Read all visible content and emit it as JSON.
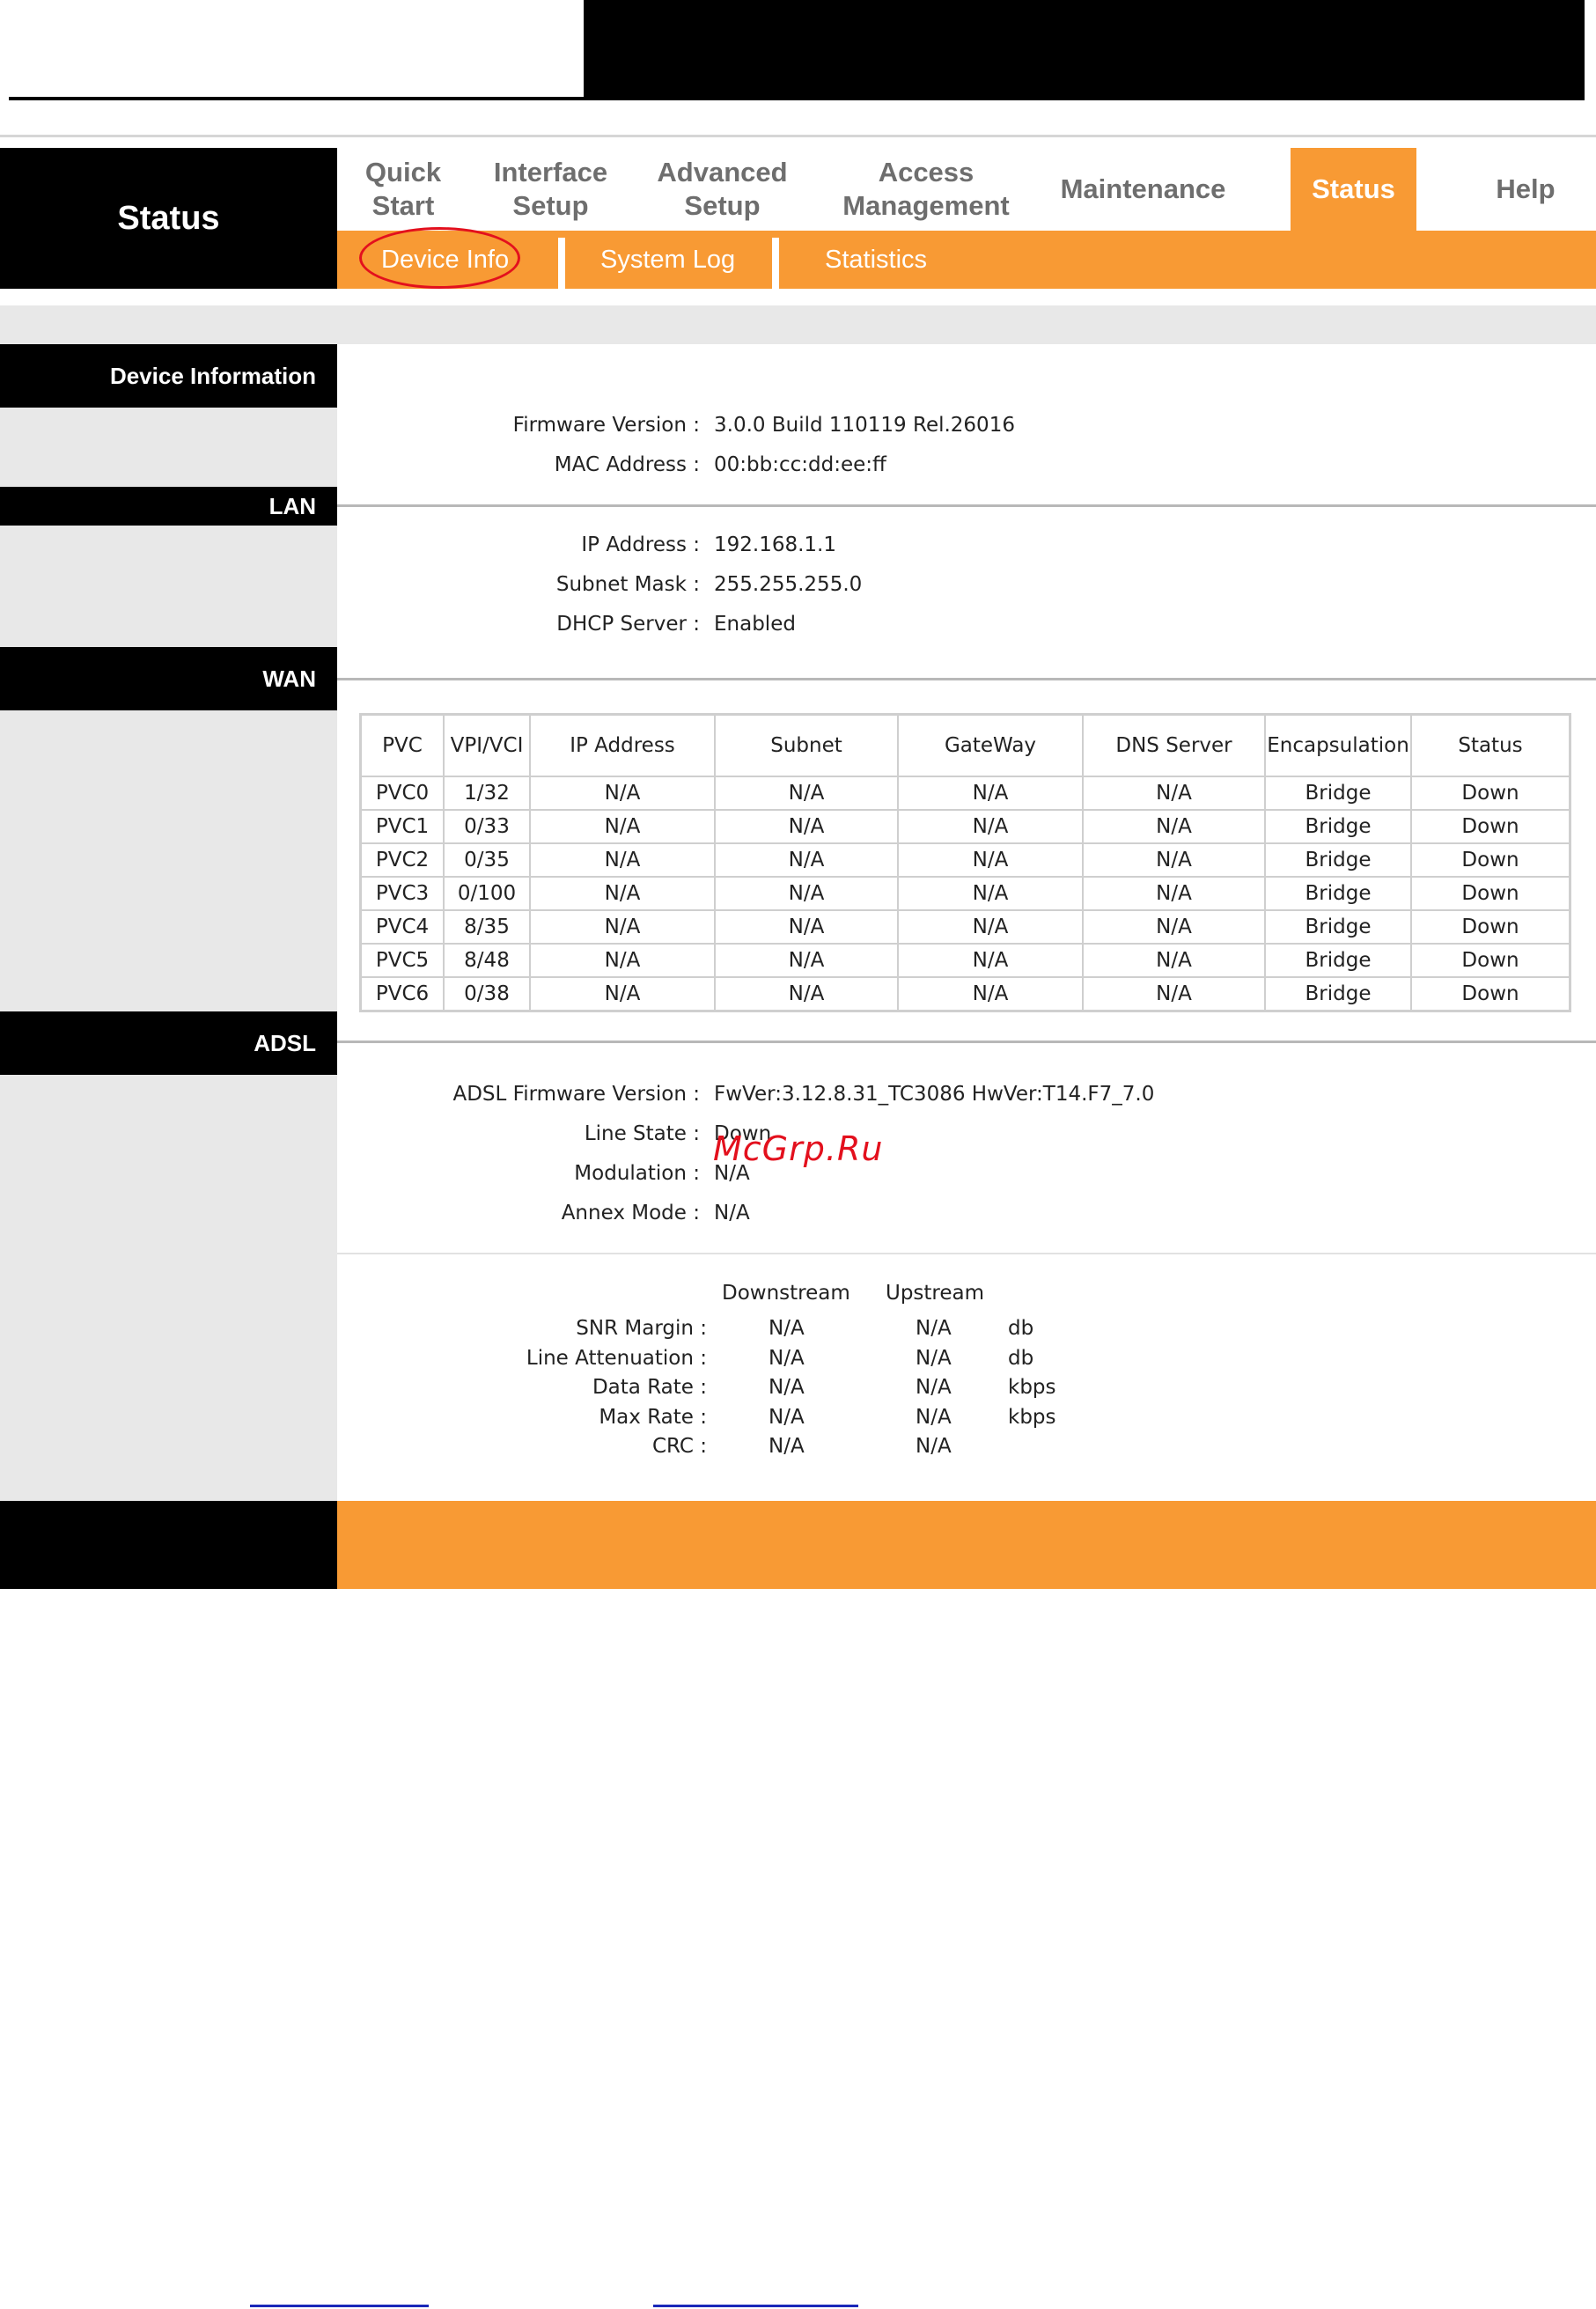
{
  "router_ui": {
    "page_title": "Status",
    "nav": [
      {
        "label": "Quick\nStart",
        "active": false
      },
      {
        "label": "Interface\nSetup",
        "active": false
      },
      {
        "label": "Advanced\nSetup",
        "active": false
      },
      {
        "label": "Access\nManagement",
        "active": false
      },
      {
        "label": "Maintenance",
        "active": false
      },
      {
        "label": "Status",
        "active": true
      },
      {
        "label": "Help",
        "active": false
      }
    ],
    "subnav": [
      "Device Info",
      "System Log",
      "Statistics"
    ],
    "colors": {
      "accent": "#f89a34",
      "highlight_circle": "#e3101d",
      "sidebar": "#000000",
      "panel": "#e8e8e8"
    }
  },
  "device_information": {
    "section_label": "Device Information",
    "firmware_label": "Firmware Version :",
    "firmware_value": "3.0.0 Build 110119 Rel.26016",
    "mac_label": "MAC Address :",
    "mac_value": "00:bb:cc:dd:ee:ff"
  },
  "lan": {
    "section_label": "LAN",
    "ip_label": "IP Address :",
    "ip_value": "192.168.1.1",
    "mask_label": "Subnet Mask :",
    "mask_value": "255.255.255.0",
    "dhcp_label": "DHCP Server :",
    "dhcp_value": "Enabled"
  },
  "wan": {
    "section_label": "WAN",
    "columns": [
      "PVC",
      "VPI/VCI",
      "IP Address",
      "Subnet",
      "GateWay",
      "DNS Server",
      "Encapsulation",
      "Status"
    ],
    "rows": [
      [
        "PVC0",
        "1/32",
        "N/A",
        "N/A",
        "N/A",
        "N/A",
        "Bridge",
        "Down"
      ],
      [
        "PVC1",
        "0/33",
        "N/A",
        "N/A",
        "N/A",
        "N/A",
        "Bridge",
        "Down"
      ],
      [
        "PVC2",
        "0/35",
        "N/A",
        "N/A",
        "N/A",
        "N/A",
        "Bridge",
        "Down"
      ],
      [
        "PVC3",
        "0/100",
        "N/A",
        "N/A",
        "N/A",
        "N/A",
        "Bridge",
        "Down"
      ],
      [
        "PVC4",
        "8/35",
        "N/A",
        "N/A",
        "N/A",
        "N/A",
        "Bridge",
        "Down"
      ],
      [
        "PVC5",
        "8/48",
        "N/A",
        "N/A",
        "N/A",
        "N/A",
        "Bridge",
        "Down"
      ],
      [
        "PVC6",
        "0/38",
        "N/A",
        "N/A",
        "N/A",
        "N/A",
        "Bridge",
        "Down"
      ]
    ]
  },
  "adsl": {
    "section_label": "ADSL",
    "fw_label": "ADSL Firmware Version :",
    "fw_value": "FwVer:3.12.8.31_TC3086 HwVer:T14.F7_7.0",
    "line_state_label": "Line State :",
    "line_state_value": "Down",
    "modulation_label": "Modulation :",
    "modulation_value": "N/A",
    "annex_label": "Annex Mode :",
    "annex_value": "N/A",
    "downstream_header": "Downstream",
    "upstream_header": "Upstream",
    "stats": [
      {
        "label": "SNR Margin :",
        "down": "N/A",
        "up": "N/A",
        "unit": "db"
      },
      {
        "label": "Line Attenuation :",
        "down": "N/A",
        "up": "N/A",
        "unit": "db"
      },
      {
        "label": "Data Rate :",
        "down": "N/A",
        "up": "N/A",
        "unit": "kbps"
      },
      {
        "label": "Max Rate :",
        "down": "N/A",
        "up": "N/A",
        "unit": "kbps"
      },
      {
        "label": "CRC :",
        "down": "N/A",
        "up": "N/A",
        "unit": ""
      }
    ]
  },
  "watermark": "McGrp.Ru"
}
